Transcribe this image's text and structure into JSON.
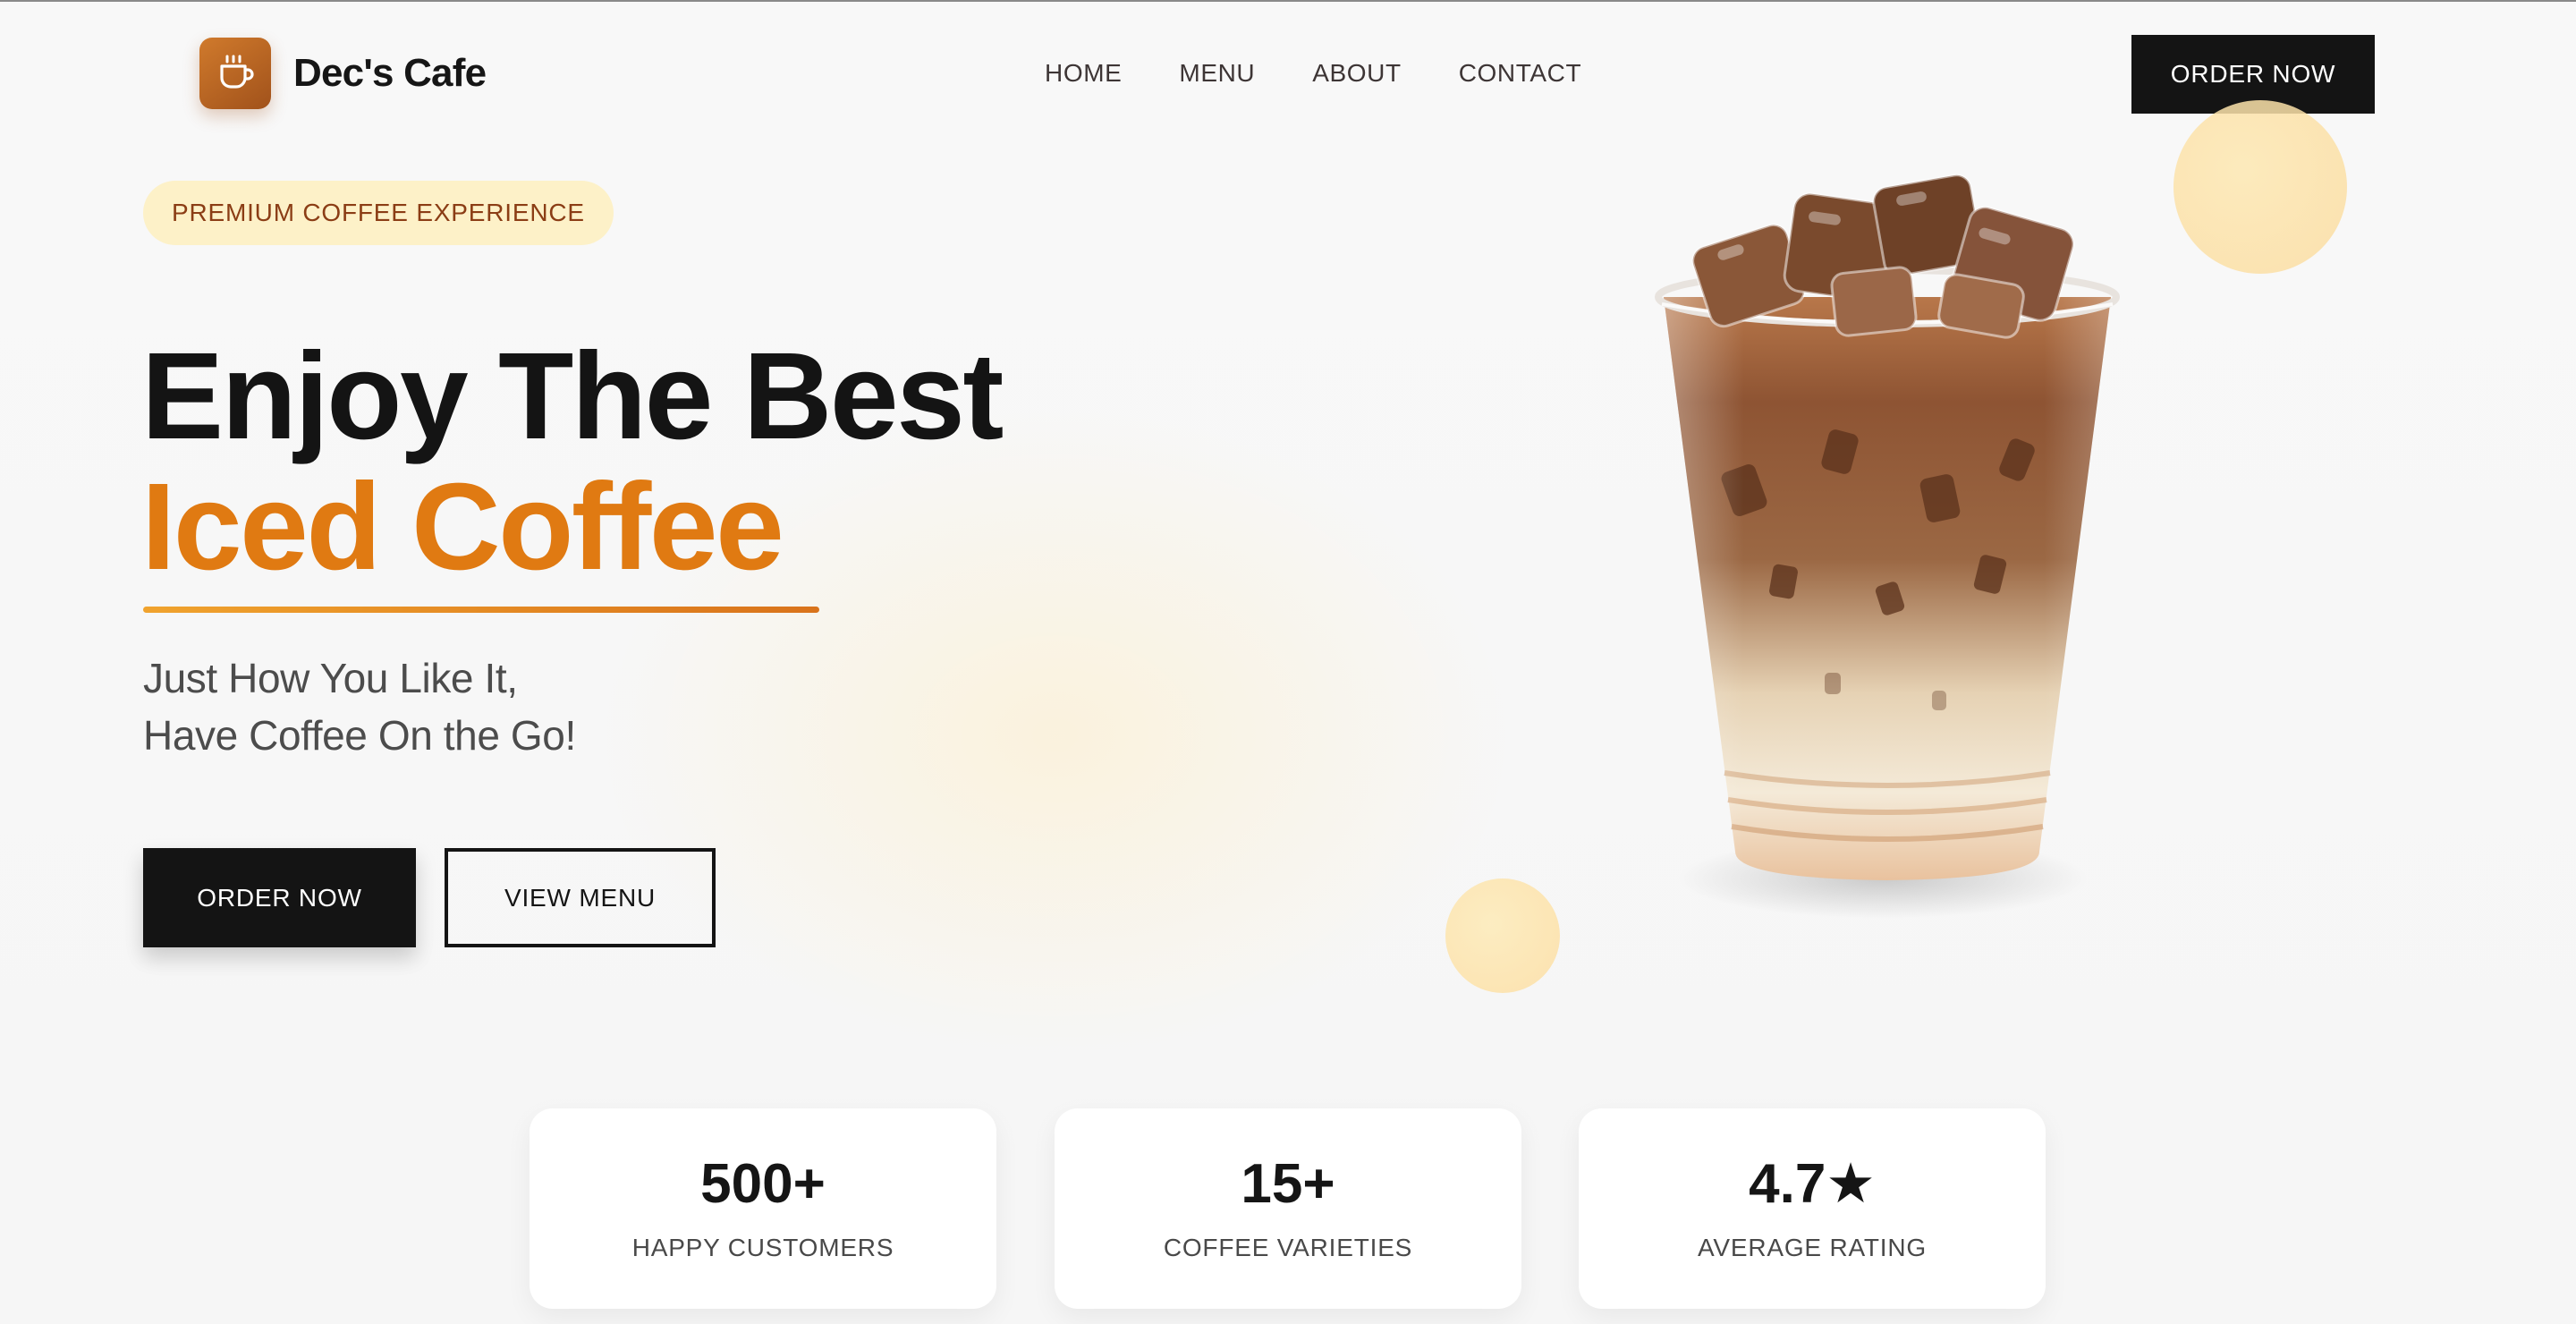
{
  "header": {
    "brand": "Dec's Cafe",
    "logo_icon": "coffee-cup-icon",
    "nav": [
      {
        "label": "HOME"
      },
      {
        "label": "MENU"
      },
      {
        "label": "ABOUT"
      },
      {
        "label": "CONTACT"
      }
    ],
    "order_button": "ORDER NOW"
  },
  "hero": {
    "tagline": "PREMIUM COFFEE EXPERIENCE",
    "title": "Enjoy The Best",
    "title_accent": "Iced Coffee",
    "subtitle_line1": "Just How You Like It,",
    "subtitle_line2": "Have Coffee On the Go!",
    "primary_button": "ORDER NOW",
    "secondary_button": "VIEW MENU",
    "image": "iced-coffee-cup"
  },
  "stats": [
    {
      "value": "500+",
      "label": "HAPPY CUSTOMERS"
    },
    {
      "value": "15+",
      "label": "COFFEE VARIETIES"
    },
    {
      "value": "4.7★",
      "label": "AVERAGE RATING"
    }
  ],
  "colors": {
    "accent": "#e07a12",
    "dark": "#141414",
    "tagline_bg": "#fdf1c8",
    "tagline_text": "#8b3d15",
    "circle": "#fde3a8"
  }
}
